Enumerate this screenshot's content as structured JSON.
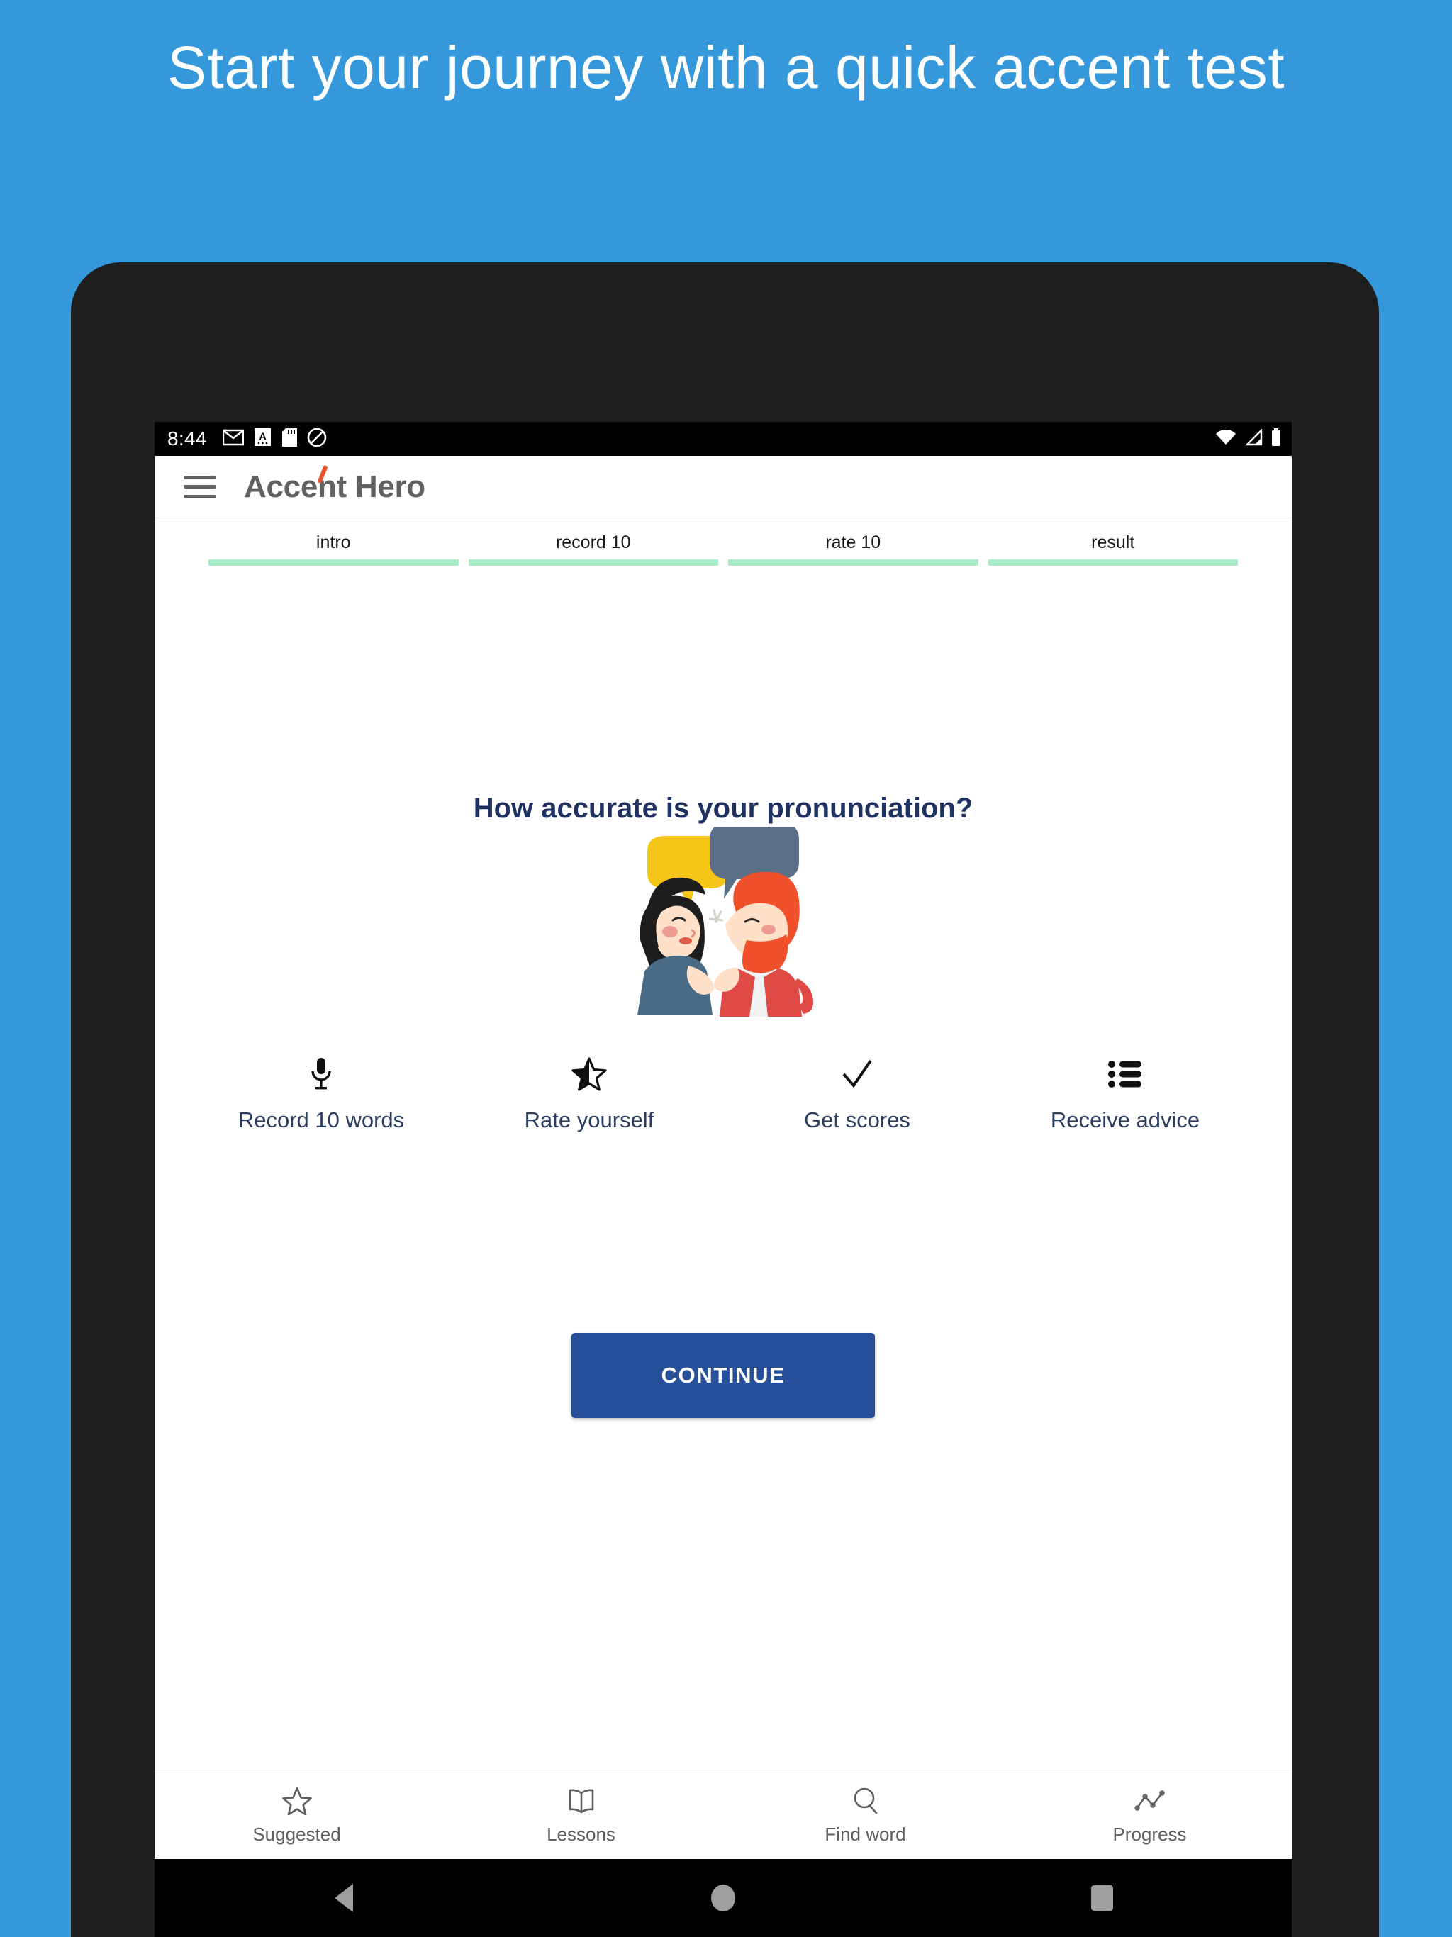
{
  "promo": {
    "headline": "Start your journey with a quick accent test",
    "background_color": "#3498db",
    "text_color": "#ffffff"
  },
  "status_bar": {
    "clock": "8:44",
    "left_icons": [
      "gmail-icon",
      "keyboard-language-icon",
      "sd-card-icon",
      "do-not-disturb-icon"
    ],
    "right_icons": [
      "wifi-icon",
      "cellular-signal-icon",
      "battery-icon"
    ]
  },
  "app_bar": {
    "menu_icon": "hamburger-menu-icon",
    "title": "Accent Hero",
    "title_color": "#616161",
    "accent_color": "#e8502a"
  },
  "stepper": {
    "bar_color": "#a9edc6",
    "steps": [
      {
        "label": "intro"
      },
      {
        "label": "record 10"
      },
      {
        "label": "rate 10"
      },
      {
        "label": "result"
      }
    ]
  },
  "main": {
    "headline": "How accurate is your pronunciation?",
    "headline_color": "#1f3161",
    "illustration": "two-people-talking-illustration",
    "features": [
      {
        "icon": "microphone-icon",
        "label": "Record 10 words"
      },
      {
        "icon": "star-half-icon",
        "label": "Rate yourself"
      },
      {
        "icon": "check-icon",
        "label": "Get scores"
      },
      {
        "icon": "list-icon",
        "label": "Receive advice"
      }
    ],
    "continue_label": "CONTINUE",
    "continue_color": "#26509a"
  },
  "bottom_nav": {
    "items": [
      {
        "icon": "star-outline-icon",
        "label": "Suggested"
      },
      {
        "icon": "book-icon",
        "label": "Lessons"
      },
      {
        "icon": "search-icon",
        "label": "Find word"
      },
      {
        "icon": "chart-line-icon",
        "label": "Progress"
      }
    ]
  },
  "system_nav": {
    "buttons": [
      "back-button",
      "home-button",
      "recents-button"
    ]
  }
}
